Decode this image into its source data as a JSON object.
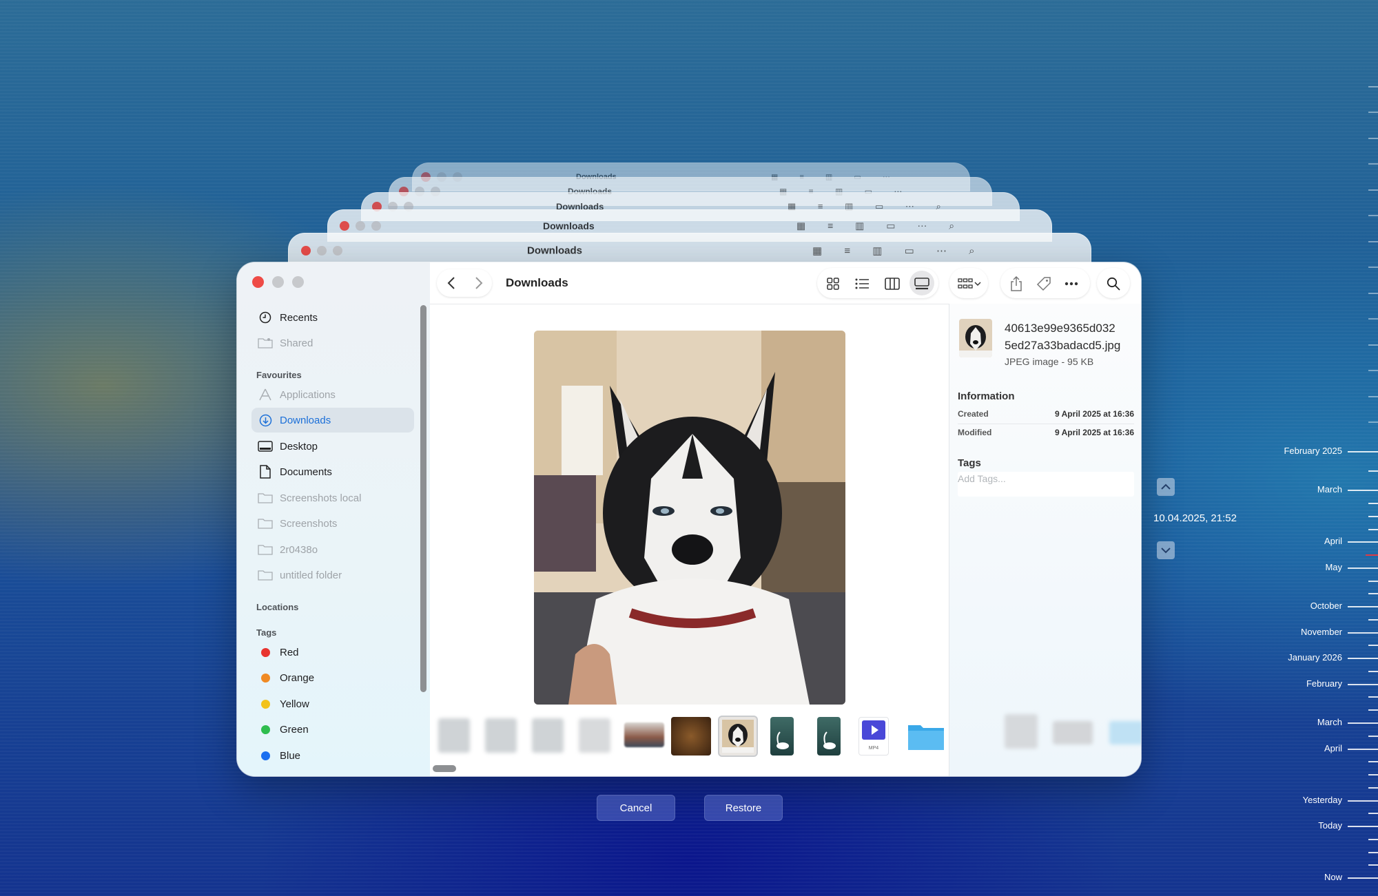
{
  "window": {
    "title": "Downloads"
  },
  "back_windows": [
    {
      "title": "Downloads"
    },
    {
      "title": "Downloads"
    },
    {
      "title": "Downloads"
    },
    {
      "title": "Downloads"
    },
    {
      "title": "Downloads"
    }
  ],
  "sidebar": {
    "top_items": [
      {
        "label": "Recents",
        "icon": "clock-icon",
        "dim": false
      },
      {
        "label": "Shared",
        "icon": "shared-folder-icon",
        "dim": true
      }
    ],
    "favourites_heading": "Favourites",
    "favourites": [
      {
        "label": "Applications",
        "icon": "applications-icon",
        "dim": true,
        "selected": false
      },
      {
        "label": "Downloads",
        "icon": "downloads-icon",
        "dim": false,
        "selected": true
      },
      {
        "label": "Desktop",
        "icon": "desktop-icon",
        "dim": false,
        "selected": false
      },
      {
        "label": "Documents",
        "icon": "document-icon",
        "dim": false,
        "selected": false
      },
      {
        "label": "Screenshots local",
        "icon": "folder-icon",
        "dim": true,
        "selected": false
      },
      {
        "label": "Screenshots",
        "icon": "folder-icon",
        "dim": true,
        "selected": false
      },
      {
        "label": "2r0438o",
        "icon": "folder-icon",
        "dim": true,
        "selected": false
      },
      {
        "label": "untitled folder",
        "icon": "folder-icon",
        "dim": true,
        "selected": false
      }
    ],
    "locations_heading": "Locations",
    "tags_heading": "Tags",
    "tags": [
      {
        "label": "Red",
        "color": "#e8342f"
      },
      {
        "label": "Orange",
        "color": "#f08a24"
      },
      {
        "label": "Yellow",
        "color": "#f2c21b"
      },
      {
        "label": "Green",
        "color": "#2ebd4e"
      },
      {
        "label": "Blue",
        "color": "#1a6ff0"
      }
    ]
  },
  "inspector": {
    "file_name": "40613e99e9365d0325ed27a33badacd5.jpg",
    "file_name_line1": "40613e99e9365d032",
    "file_name_line2": "5ed27a33badacd5.jpg",
    "file_info": "JPEG image - 95 KB",
    "information_heading": "Information",
    "created_label": "Created",
    "created_value": "9 April 2025 at 16:36",
    "modified_label": "Modified",
    "modified_value": "9 April 2025 at 16:36",
    "tags_heading": "Tags",
    "tags_placeholder": "Add Tags..."
  },
  "thumbnails": [
    {
      "kind": "blurred"
    },
    {
      "kind": "blurred"
    },
    {
      "kind": "blurred"
    },
    {
      "kind": "blurred"
    },
    {
      "kind": "photo-room"
    },
    {
      "kind": "photo-dark"
    },
    {
      "kind": "husky",
      "selected": true
    },
    {
      "kind": "swan"
    },
    {
      "kind": "swan"
    },
    {
      "kind": "mp4",
      "label": "MP4"
    },
    {
      "kind": "folder"
    }
  ],
  "time_machine": {
    "current_snapshot": "10.04.2025, 21:52",
    "cancel_label": "Cancel",
    "restore_label": "Restore",
    "timeline": [
      "February 2025",
      "March",
      "April",
      "May",
      "October",
      "November",
      "January 2026",
      "February",
      "March",
      "April",
      "Yesterday",
      "Today",
      "Now"
    ]
  },
  "colors": {
    "accent": "#1b6fd8",
    "close": "#ee4b46"
  }
}
